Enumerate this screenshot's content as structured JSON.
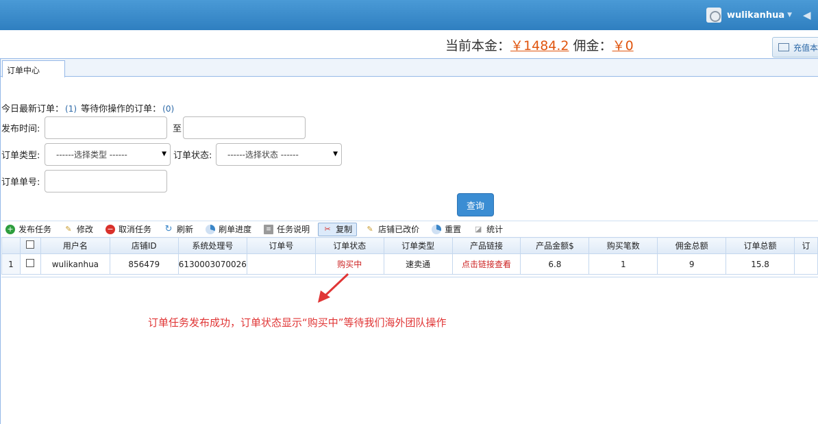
{
  "header": {
    "username": "wulikanhua",
    "recharge_label": "充值本"
  },
  "balance": {
    "principal_label": "当前本金：",
    "principal_value": "￥1484.2",
    "commission_label": "佣金：",
    "commission_value": "￥0"
  },
  "tabs": [
    {
      "label": "订单中心"
    }
  ],
  "summary": {
    "today_label": "今日最新订单：",
    "today_count": "(1)",
    "waiting_label": "等待你操作的订单：",
    "waiting_count": "(0)"
  },
  "filters": {
    "publish_time_label": "发布时间:",
    "to_label": "至",
    "order_type_label": "订单类型:",
    "order_type_value": "------选择类型 ------",
    "order_status_label": "订单状态:",
    "order_status_value": "------选择状态 ------",
    "order_no_label": "订单单号:",
    "query_button": "查询"
  },
  "toolbar": [
    {
      "label": "发布任务",
      "icon": "add-icon",
      "color": "#2e9e3e"
    },
    {
      "label": "修改",
      "icon": "pencil-icon",
      "color": "#c89a2c"
    },
    {
      "label": "取消任务",
      "icon": "cancel-icon",
      "color": "#d9312b"
    },
    {
      "label": "刷新",
      "icon": "refresh-icon",
      "color": "#3a86c8"
    },
    {
      "label": "刷单进度",
      "icon": "progress-icon",
      "color": "#3a86c8"
    },
    {
      "label": "任务说明",
      "icon": "document-icon",
      "color": "#7a7a7a"
    },
    {
      "label": "复制",
      "icon": "scissors-icon",
      "color": "#d9312b"
    },
    {
      "label": "店铺已改价",
      "icon": "pencil-icon",
      "color": "#c89a2c"
    },
    {
      "label": "重置",
      "icon": "reset-icon",
      "color": "#3a86c8"
    },
    {
      "label": "统计",
      "icon": "eraser-icon",
      "color": "#9a9a9a"
    }
  ],
  "table": {
    "columns": [
      "用户名",
      "店铺ID",
      "系统处理号",
      "订单号",
      "订单状态",
      "订单类型",
      "产品链接",
      "产品金额$",
      "购买笔数",
      "佣金总额",
      "订单总额",
      "订"
    ],
    "rows": [
      {
        "index": "1",
        "cells": [
          "wulikanhua",
          "856479",
          "6130003070026",
          "",
          "购买中",
          "速卖通",
          "点击链接查看",
          "6.8",
          "1",
          "9",
          "15.8",
          ""
        ]
      }
    ]
  },
  "annotation": {
    "text": "订单任务发布成功，订单状态显示“购买中”等待我们海外团队操作",
    "color": "#e03535"
  }
}
